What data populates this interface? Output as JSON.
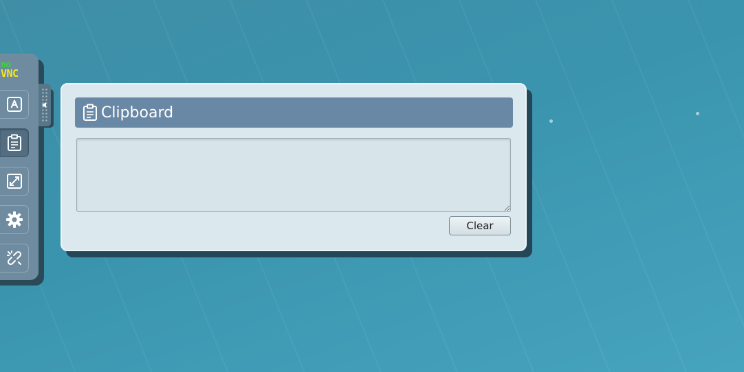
{
  "logo": {
    "line1": "no",
    "line2": "VNC"
  },
  "control_bar": {
    "buttons": [
      {
        "name": "extra-keys",
        "icon": "keyboard-a-icon",
        "active": false
      },
      {
        "name": "clipboard",
        "icon": "clipboard-icon",
        "active": true
      },
      {
        "name": "fullscreen",
        "icon": "fullscreen-icon",
        "active": false
      },
      {
        "name": "settings",
        "icon": "gear-icon",
        "active": false
      },
      {
        "name": "disconnect",
        "icon": "disconnect-icon",
        "active": false
      }
    ],
    "handle_icon": "collapse-arrow-icon"
  },
  "clipboard_panel": {
    "title": "Clipboard",
    "title_icon": "clipboard-icon",
    "text_value": "",
    "clear_label": "Clear"
  },
  "colors": {
    "desktop_bg": "#3f93ac",
    "control_bar": "#6f8ba0",
    "panel_bg": "#dbe8ee",
    "panel_header": "#6988a5",
    "logo_no": "#3bd43b",
    "logo_vnc": "#f5e81c"
  }
}
